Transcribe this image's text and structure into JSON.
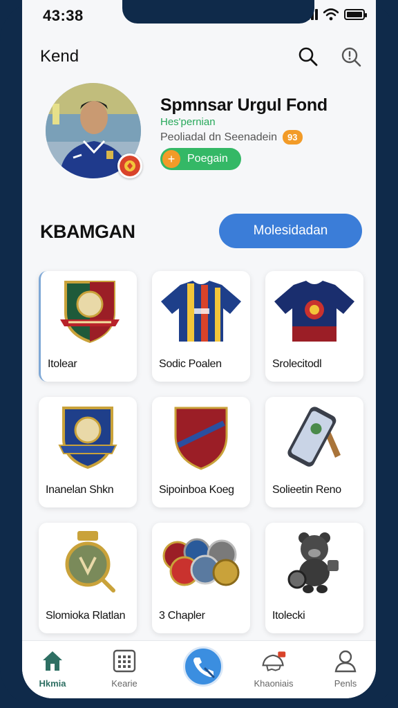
{
  "status_bar": {
    "time": "43:38"
  },
  "header": {
    "title": "Kend",
    "search_icon": "search-icon",
    "info_icon": "info-icon"
  },
  "profile": {
    "name": "Spmnsar Urgul Fond",
    "role": "Hes'pernian",
    "meta": "Peoliadal dn Seenadein",
    "meta_badge": "93",
    "follow_label": "Poegain",
    "follow_icon": "+"
  },
  "section": {
    "title": "KBAMGAN",
    "button_label": "Molesidadan"
  },
  "items": [
    {
      "label": "Itolear",
      "icon": "crest-icon"
    },
    {
      "label": "Sodic Poalen",
      "icon": "striped-jersey-icon"
    },
    {
      "label": "Srolecitodl",
      "icon": "navy-jersey-icon"
    },
    {
      "label": "Inanelan Shkn",
      "icon": "blue-badge-icon"
    },
    {
      "label": "Sipoinboa Koeg",
      "icon": "red-shield-icon"
    },
    {
      "label": "Solieetin Reno",
      "icon": "phone-stand-icon"
    },
    {
      "label": "Slomioka Rlatlan",
      "icon": "medal-icon"
    },
    {
      "label": "3 Chapler",
      "icon": "coins-icon"
    },
    {
      "label": "Itolecki",
      "icon": "bear-figure-icon"
    }
  ],
  "tabbar": {
    "tabs": [
      {
        "label": "Hkmia",
        "icon": "home-icon",
        "active": true
      },
      {
        "label": "Kearie",
        "icon": "grid-calendar-icon"
      },
      {
        "label": "",
        "icon": "phone-fab-icon"
      },
      {
        "label": "Khaoniais",
        "icon": "notification-icon"
      },
      {
        "label": "Penls",
        "icon": "profile-icon"
      }
    ]
  },
  "colors": {
    "accent": "#3b7dd8",
    "green": "#34b866",
    "orange": "#f29b28",
    "frame": "#0f2a4a"
  }
}
